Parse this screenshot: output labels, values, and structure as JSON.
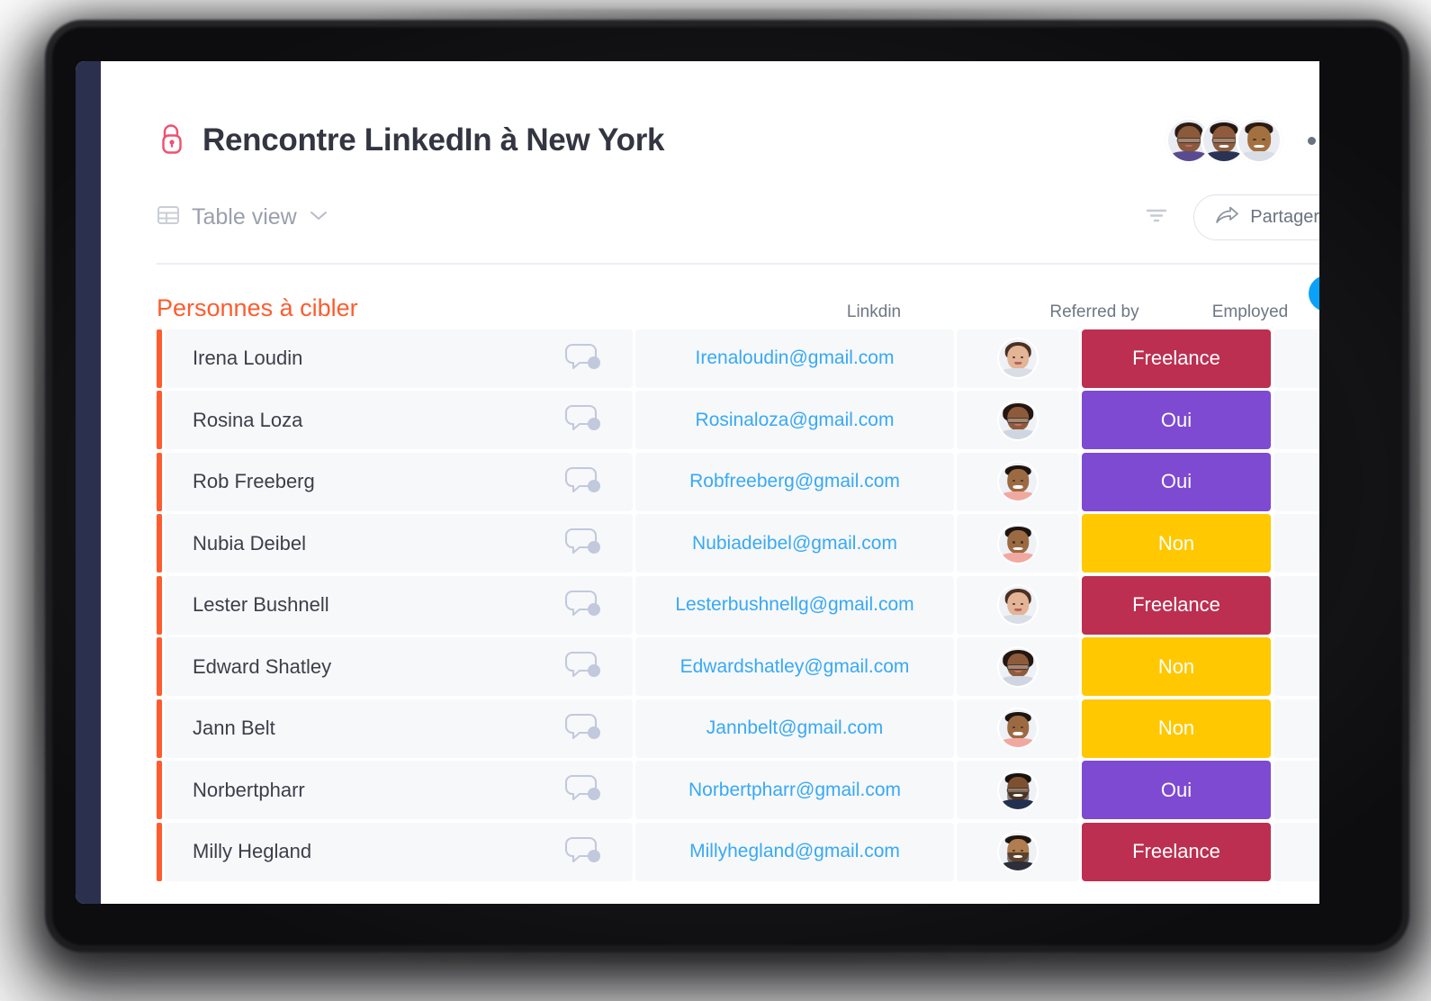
{
  "board": {
    "title": "Rencontre LinkedIn à New York",
    "lock_icon": "open-padlock-icon",
    "more_menu_icon": "more-horizontal-icon"
  },
  "toolbar": {
    "view_label": "Table view",
    "view_icon": "table-view-icon",
    "chevron_icon": "chevron-down-icon",
    "filter_icon": "filter-icon",
    "share_label": "Partager",
    "share_icon": "share-arrow-icon"
  },
  "header_avatars": [
    {
      "name": "collaborator-avatar-1"
    },
    {
      "name": "collaborator-avatar-2"
    },
    {
      "name": "collaborator-avatar-3"
    }
  ],
  "table": {
    "group_title": "Personnes à cibler",
    "add_column_icon": "plus-icon",
    "columns": [
      {
        "key": "name",
        "label": ""
      },
      {
        "key": "linkdin",
        "label": "Linkdin"
      },
      {
        "key": "referred_by",
        "label": "Referred by"
      },
      {
        "key": "employed",
        "label": "Employed"
      }
    ],
    "conversation_icon": "chat-bubble-icon",
    "rows": [
      {
        "name": "Irena Loudin",
        "email": "Irenaloudin@gmail.com",
        "status": "Freelance",
        "status_color": "#bc2f50",
        "avatar": "avatar-woman-brown-hair"
      },
      {
        "name": "Rosina Loza",
        "email": "Rosinaloza@gmail.com",
        "status": "Oui",
        "status_color": "#7e4ad1",
        "avatar": "avatar-woman-curly-glasses"
      },
      {
        "name": "Rob Freeberg",
        "email": "Robfreeberg@gmail.com",
        "status": "Oui",
        "status_color": "#7e4ad1",
        "avatar": "avatar-man-short-hair"
      },
      {
        "name": "Nubia Deibel",
        "email": "Nubiadeibel@gmail.com",
        "status": "Non",
        "status_color": "#ffc800",
        "avatar": "avatar-man-short-hair"
      },
      {
        "name": "Lester Bushnell",
        "email": "Lesterbushnellg@gmail.com",
        "status": "Freelance",
        "status_color": "#bc2f50",
        "avatar": "avatar-woman-brown-hair"
      },
      {
        "name": "Edward Shatley",
        "email": "Edwardshatley@gmail.com",
        "status": "Non",
        "status_color": "#ffc800",
        "avatar": "avatar-woman-curly-glasses"
      },
      {
        "name": "Jann Belt",
        "email": "Jannbelt@gmail.com",
        "status": "Non",
        "status_color": "#ffc800",
        "avatar": "avatar-man-short-hair"
      },
      {
        "name": "Norbertpharr",
        "email": "Norbertpharr@gmail.com",
        "status": "Oui",
        "status_color": "#7e4ad1",
        "avatar": "avatar-man-glasses-beard"
      },
      {
        "name": "Milly Hegland",
        "email": "Millyhegland@gmail.com",
        "status": "Freelance",
        "status_color": "#bc2f50",
        "avatar": "avatar-man-beard"
      }
    ]
  },
  "colors": {
    "accent_orange": "#fd5c2e",
    "link_blue": "#37a9f5",
    "add_button_blue": "#0aa2f7",
    "sidebar_navy": "#2b304f",
    "lock_pink": "#f0506e",
    "status_freelance": "#bc2f50",
    "status_oui": "#7e4ad1",
    "status_non": "#ffc800"
  }
}
